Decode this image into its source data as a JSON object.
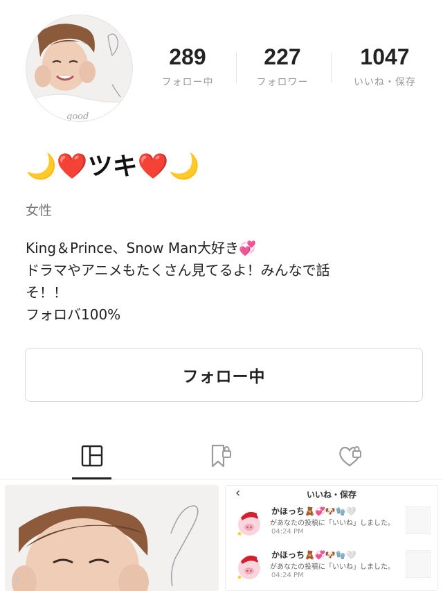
{
  "profile": {
    "display_name": "🌙❤️ツキ❤️🌙",
    "gender": "女性",
    "bio_lines": [
      "King＆Prince、Snow Man大好き💞",
      "ドラマやアニメもたくさん見てるよ！みんなで話",
      "そ！！",
      "フォロバ100%"
    ],
    "avatar_text": "good"
  },
  "stats": {
    "following": {
      "value": "289",
      "label": "フォロー中"
    },
    "followers": {
      "value": "227",
      "label": "フォロワー"
    },
    "likes": {
      "value": "1047",
      "label": "いいね・保存"
    }
  },
  "follow_button": {
    "label": "フォロー中"
  },
  "tabs": [
    {
      "icon": "grid-icon",
      "active": true
    },
    {
      "icon": "bookmark-lock-icon",
      "active": false
    },
    {
      "icon": "heart-lock-icon",
      "active": false
    }
  ],
  "posts": {
    "post2": {
      "header_title": "いいね・保存",
      "back_glyph": "‹",
      "notifications": [
        {
          "name": "かほっち🧸💞🐶🧤🤍",
          "message": "があなたの投稿に「いいね」しました。",
          "time": "04:24 PM"
        },
        {
          "name": "かほっち🧸💞🐶🧤🤍",
          "message": "があなたの投稿に「いいね」しました。",
          "time": "04:24 PM"
        }
      ]
    }
  },
  "colors": {
    "text_primary": "#222222",
    "text_muted": "#999999",
    "border": "#d9d9d9",
    "accent_heart": "#e53945"
  }
}
